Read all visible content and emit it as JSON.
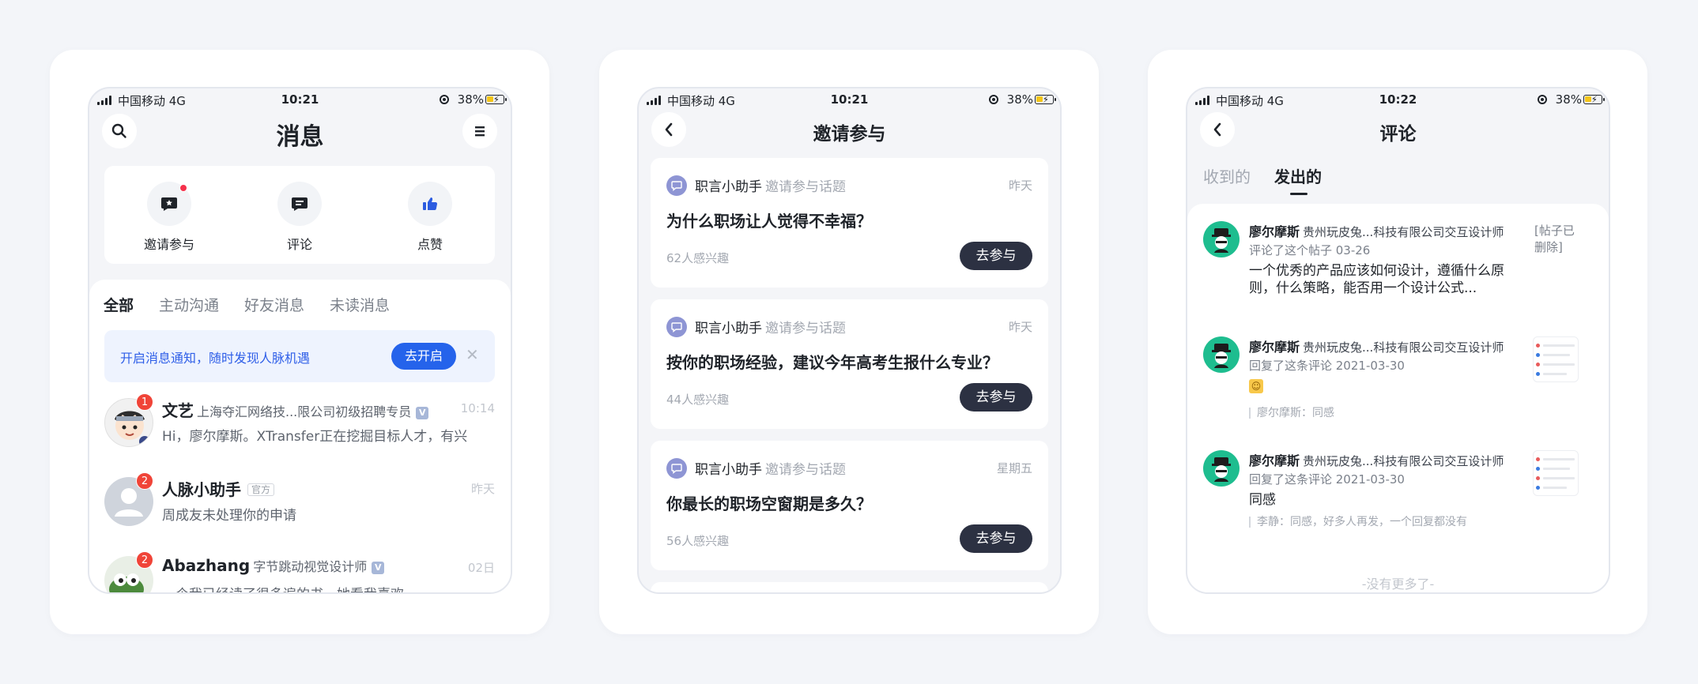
{
  "status": {
    "carrier": "中国移动  4G",
    "battery": "38%",
    "phone1_time": "10:21",
    "phone2_time": "10:21",
    "phone3_time": "10:22"
  },
  "messages_screen": {
    "title": "消息",
    "quick_actions": [
      {
        "label": "邀请参与",
        "icon": "star-chat-icon"
      },
      {
        "label": "评论",
        "icon": "comment-icon"
      },
      {
        "label": "点赞",
        "icon": "thumbs-up-icon"
      }
    ],
    "tabs": [
      "全部",
      "主动沟通",
      "好友消息",
      "未读消息"
    ],
    "notice": {
      "text": "开启消息通知，随时发现人脉机遇",
      "button": "去开启"
    },
    "items": [
      {
        "name": "文艺",
        "subtitle": "上海夺汇网络技...限公司初级招聘专员",
        "time": "10:14",
        "preview": "Hi，廖尔摩斯。XTransfer正在挖掘目标人才，有兴",
        "badge": "1"
      },
      {
        "name": "人脉小助手",
        "tag": "官方",
        "time": "昨天",
        "preview": "周成友未处理你的申请",
        "badge": "2"
      },
      {
        "name": "Abazhang",
        "subtitle": "字节跳动视觉设计师",
        "time": "02日",
        "preview": "一个我已经读了很多遍的书，她看我喜欢",
        "badge": "2"
      }
    ]
  },
  "invite_screen": {
    "title": "邀请参与",
    "items": [
      {
        "sender": "职言小助手",
        "action": "邀请参与话题",
        "time": "昨天",
        "question": "为什么职场让人觉得不幸福？",
        "interest": "62人感兴趣",
        "button": "去参与"
      },
      {
        "sender": "职言小助手",
        "action": "邀请参与话题",
        "time": "昨天",
        "question": "按你的职场经验，建议今年高考生报什么专业？",
        "interest": "44人感兴趣",
        "button": "去参与"
      },
      {
        "sender": "职言小助手",
        "action": "邀请参与话题",
        "time": "星期五",
        "question": "你最长的职场空窗期是多久？",
        "interest": "56人感兴趣",
        "button": "去参与"
      }
    ]
  },
  "comments_screen": {
    "title": "评论",
    "tabs": [
      "收到的",
      "发出的"
    ],
    "items": [
      {
        "name": "廖尔摩斯",
        "company": "贵州玩皮兔...科技有限公司交互设计师",
        "action": "评论了这个帖子  03-26",
        "body": "一个优秀的产品应该如何设计，遵循什么原则，什么策略，能否用一个设计公式...",
        "side": "[帖子已删除]"
      },
      {
        "name": "廖尔摩斯",
        "company": "贵州玩皮兔...科技有限公司交互设计师",
        "action": "回复了这条评论  2021-03-30",
        "quote": "廖尔摩斯：同感"
      },
      {
        "name": "廖尔摩斯",
        "company": "贵州玩皮兔...科技有限公司交互设计师",
        "action": "回复了这条评论  2021-03-30",
        "body": "同感",
        "quote": "李静：同感，好多人再发，一个回复都没有"
      }
    ],
    "footer": "-没有更多了-"
  }
}
